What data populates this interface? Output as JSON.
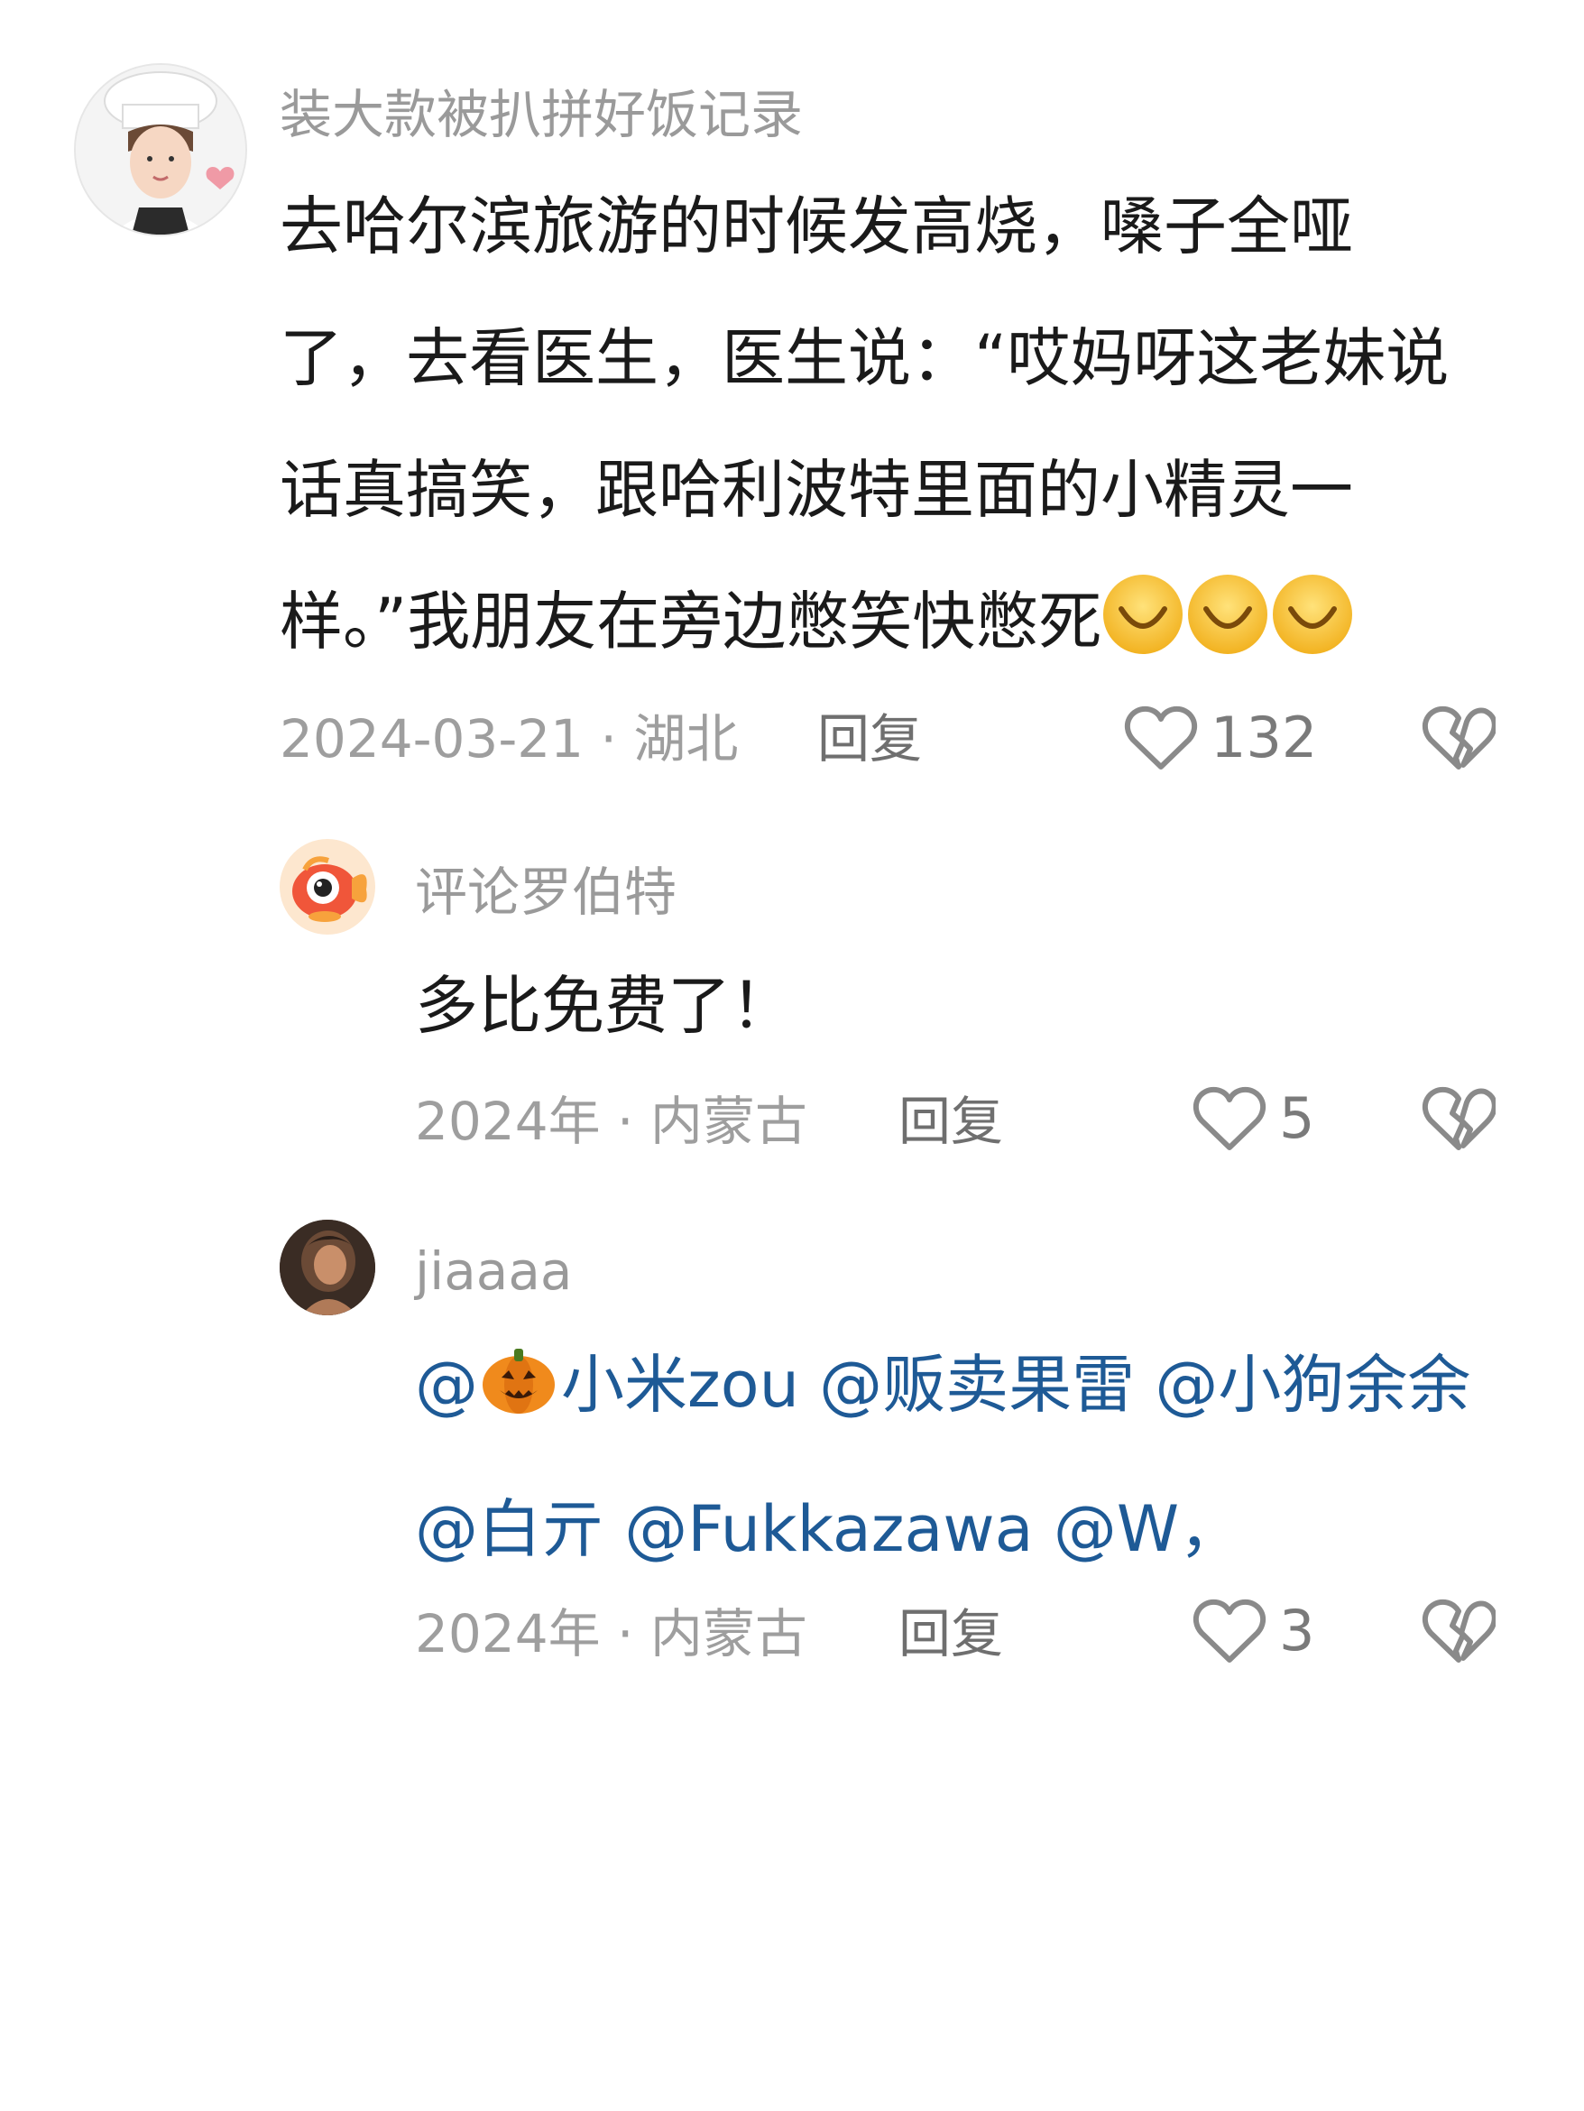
{
  "comments": [
    {
      "username": "装大款被扒拼好饭记录",
      "text_lines": [
        "去哈尔滨旅游的时候发高烧，嗓子全哑",
        "了，去看医生，医生说：“哎妈呀这老妹说",
        "话真搞笑，跟哈利波特里面的小精灵一",
        "样。”我朋友在旁边憋笑快憋死"
      ],
      "emoji_count": 3,
      "date": "2024-03-21",
      "location": "湖北",
      "meta": "2024-03-21 · 湖北",
      "reply_label": "回复",
      "likes": "132"
    },
    {
      "username": "评论罗伯特",
      "text": "多比免费了！",
      "meta": "2024年 · 内蒙古",
      "reply_label": "回复",
      "likes": "5"
    },
    {
      "username": "jiaaaa",
      "mentions_line1_a": "@",
      "mentions_line1_b": "小米zou @贩卖果雷 @小狗余余",
      "mentions_line2": "@白亓 @Fukkazawa @W，",
      "meta": "2024年 · 内蒙古",
      "reply_label": "回复",
      "likes": "3"
    }
  ],
  "icons": {
    "like": "heart-outline-icon",
    "dislike": "broken-heart-icon",
    "emoji": "smile-emoji-icon",
    "pumpkin": "pumpkin-emoji-icon"
  },
  "colors": {
    "text": "#1a1a1a",
    "meta": "#9e9e9e",
    "mention": "#1e5a96",
    "background": "#ffffff"
  }
}
